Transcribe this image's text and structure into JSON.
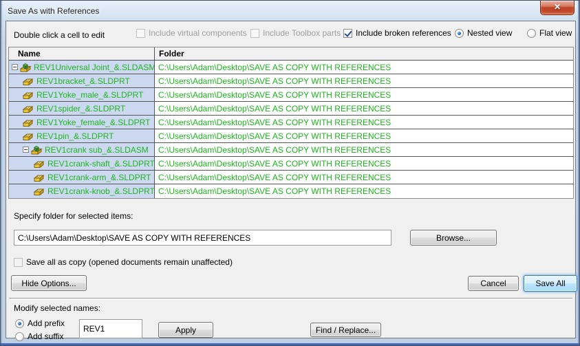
{
  "window": {
    "title": "Save As with References",
    "close_glyph": "✕"
  },
  "toolbar": {
    "hint": "Double click a cell to edit",
    "checkboxes": [
      {
        "label": "Include virtual components",
        "checked": false,
        "disabled": true
      },
      {
        "label": "Include Toolbox parts",
        "checked": false,
        "disabled": true
      },
      {
        "label": "Include broken references",
        "checked": true,
        "disabled": false
      }
    ],
    "views": [
      {
        "label": "Nested view",
        "selected": true
      },
      {
        "label": "Flat view",
        "selected": false
      }
    ]
  },
  "table": {
    "columns": [
      "Name",
      "Folder"
    ],
    "rows": [
      {
        "name": "REV1Universal Joint_&.SLDASM",
        "type": "assembly",
        "indent": 0,
        "expanded": true,
        "folder": "C:\\Users\\Adam\\Desktop\\SAVE AS COPY WITH REFERENCES"
      },
      {
        "name": "REV1bracket_&.SLDPRT",
        "type": "part",
        "indent": 1,
        "expanded": false,
        "folder": "C:\\Users\\Adam\\Desktop\\SAVE AS COPY WITH REFERENCES"
      },
      {
        "name": "REV1Yoke_male_&.SLDPRT",
        "type": "part",
        "indent": 1,
        "expanded": false,
        "folder": "C:\\Users\\Adam\\Desktop\\SAVE AS COPY WITH REFERENCES"
      },
      {
        "name": "REV1spider_&.SLDPRT",
        "type": "part",
        "indent": 1,
        "expanded": false,
        "folder": "C:\\Users\\Adam\\Desktop\\SAVE AS COPY WITH REFERENCES"
      },
      {
        "name": "REV1Yoke_female_&.SLDPRT",
        "type": "part",
        "indent": 1,
        "expanded": false,
        "folder": "C:\\Users\\Adam\\Desktop\\SAVE AS COPY WITH REFERENCES"
      },
      {
        "name": "REV1pin_&.SLDPRT",
        "type": "part",
        "indent": 1,
        "expanded": false,
        "folder": "C:\\Users\\Adam\\Desktop\\SAVE AS COPY WITH REFERENCES"
      },
      {
        "name": "REV1crank sub_&.SLDASM",
        "type": "assembly",
        "indent": 1,
        "expanded": true,
        "folder": "C:\\Users\\Adam\\Desktop\\SAVE AS COPY WITH REFERENCES"
      },
      {
        "name": "REV1crank-shaft_&.SLDPRT",
        "type": "part",
        "indent": 2,
        "expanded": false,
        "folder": "C:\\Users\\Adam\\Desktop\\SAVE AS COPY WITH REFERENCES"
      },
      {
        "name": "REV1crank-arm_&.SLDPRT",
        "type": "part",
        "indent": 2,
        "expanded": false,
        "folder": "C:\\Users\\Adam\\Desktop\\SAVE AS COPY WITH REFERENCES"
      },
      {
        "name": "REV1crank-knob_&.SLDPRT",
        "type": "part",
        "indent": 2,
        "expanded": false,
        "folder": "C:\\Users\\Adam\\Desktop\\SAVE AS COPY WITH REFERENCES"
      }
    ]
  },
  "folder_section": {
    "label": "Specify folder for selected items:",
    "path_value": "C:\\Users\\Adam\\Desktop\\SAVE AS COPY WITH REFERENCES",
    "browse_label": "Browse...",
    "save_all_copy_label": "Save all as copy (opened documents remain unaffected)",
    "save_all_copy_checked": false
  },
  "actions": {
    "hide_options": "Hide Options...",
    "cancel": "Cancel",
    "save_all": "Save All"
  },
  "modify": {
    "label": "Modify selected names:",
    "options": [
      {
        "label": "Add prefix",
        "selected": true
      },
      {
        "label": "Add suffix",
        "selected": false
      }
    ],
    "prefix_value": "REV1",
    "apply": "Apply",
    "find_replace": "Find / Replace..."
  },
  "colors": {
    "row_text_green": "#1eb41e",
    "selection_blue": "#ccd9f1",
    "default_button_border": "#3c7fb1",
    "close_button_red": "#bc4226"
  }
}
